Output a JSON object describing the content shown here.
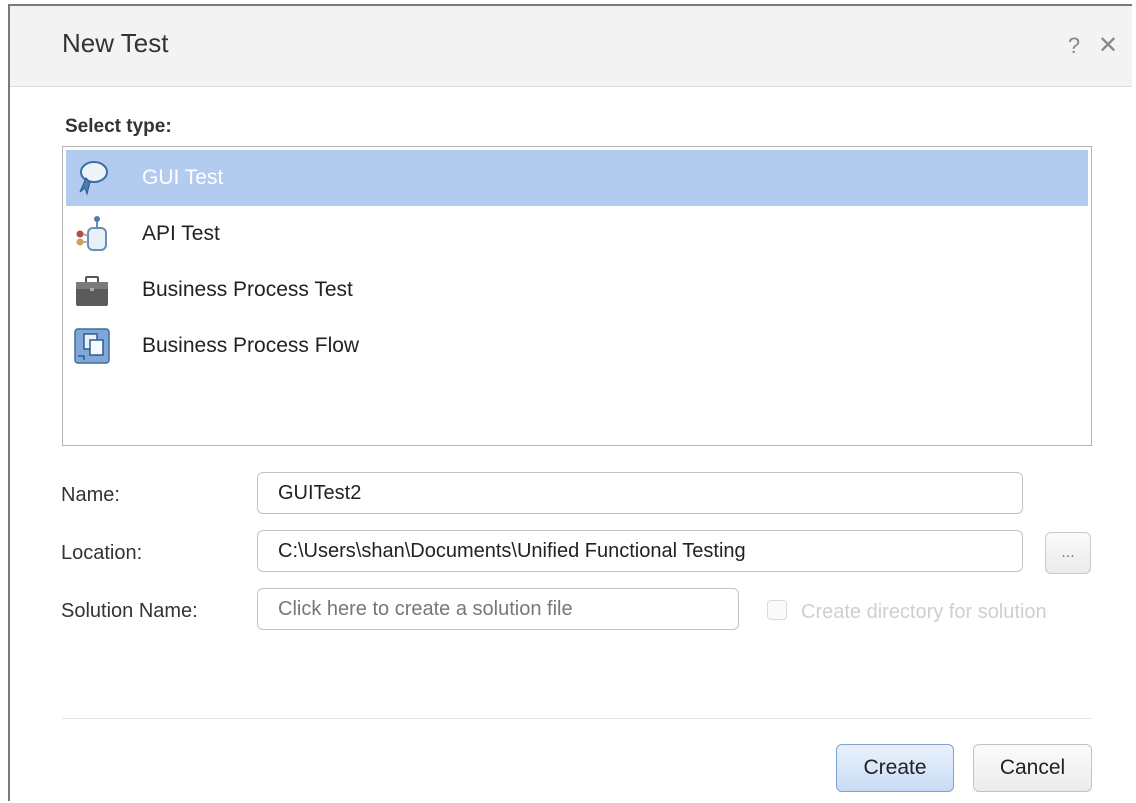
{
  "dialog": {
    "title": "New Test",
    "help_icon": "?",
    "close_icon": "✕"
  },
  "select_type": {
    "label": "Select type:",
    "items": [
      {
        "label": "GUI Test",
        "icon": "gui-test-icon",
        "selected": true
      },
      {
        "label": "API Test",
        "icon": "api-test-icon",
        "selected": false
      },
      {
        "label": "Business Process Test",
        "icon": "briefcase-icon",
        "selected": false
      },
      {
        "label": "Business Process Flow",
        "icon": "process-flow-icon",
        "selected": false
      }
    ]
  },
  "form": {
    "name_label": "Name:",
    "name_value": "GUITest2",
    "location_label": "Location:",
    "location_value": "C:\\Users\\shan\\Documents\\Unified Functional Testing",
    "browse_label": "...",
    "solution_label": "Solution Name:",
    "solution_placeholder": "Click here to create a solution file",
    "create_dir_label": "Create directory for solution",
    "create_dir_checked": false
  },
  "buttons": {
    "create": "Create",
    "cancel": "Cancel"
  },
  "colors": {
    "selection": "#b3cbee",
    "primary_button_border": "#7fa2d6"
  }
}
